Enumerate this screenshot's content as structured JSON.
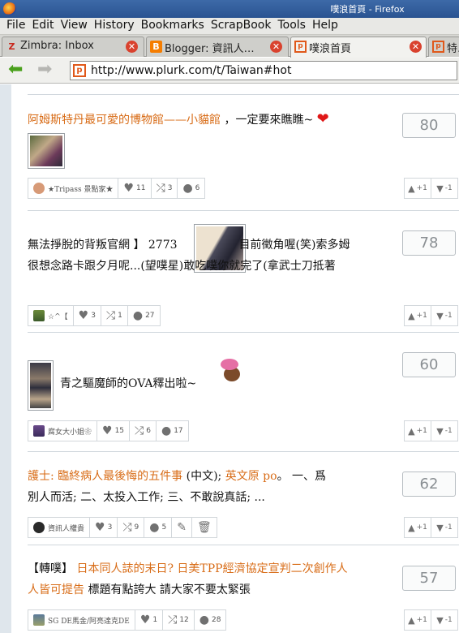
{
  "window": {
    "title": "噗浪首頁 - Firefox"
  },
  "menu": [
    "File",
    "Edit",
    "View",
    "History",
    "Bookmarks",
    "ScrapBook",
    "Tools",
    "Help"
  ],
  "tabs": [
    {
      "label": "Zimbra: Inbox",
      "favicon": "Z"
    },
    {
      "label": "Blogger: 資訊人…",
      "favicon": "B"
    },
    {
      "label": "噗浪首頁",
      "favicon": "p"
    },
    {
      "label": "特…",
      "favicon": "p"
    }
  ],
  "url": "http://www.plurk.com/t/Taiwan#hot",
  "posts": [
    {
      "text": [
        {
          "t": "阿姆斯特丹最可愛的博物館——小貓館",
          "c": "orange"
        },
        {
          "t": " ，一定要來瞧瞧~ ",
          "c": "dark"
        },
        {
          "t": "❤",
          "c": "heart"
        }
      ],
      "count": "80",
      "user": "★Tripass 景點家★",
      "likes": "11",
      "replurks": "3",
      "responses": "6",
      "plus": "+1",
      "minus": "-1"
    },
    {
      "line1a": "無法掙脫的背叛官網 】 2773",
      "line1b": "目前徵角喔(笑)索多姆",
      "line2": "很想念路卡跟夕月呢...(望噗星)敢吃噗你就完了(拿武士刀抵著",
      "count": "78",
      "user": "☆^【",
      "likes": "3",
      "replurks": "1",
      "responses": "27",
      "plus": "+1",
      "minus": "-1"
    },
    {
      "text": "青之驅魔師的OVA釋出啦~",
      "count": "60",
      "user": "腐女大小姐❀",
      "likes": "15",
      "replurks": "6",
      "responses": "17",
      "plus": "+1",
      "minus": "-1"
    },
    {
      "link1": "護士: 臨終病人最後悔的五件事",
      "mid": " (中文); ",
      "link2": "英文原 po",
      "rest1": "。 一、爲",
      "line2": "別人而活; 二、太投入工作; 三、不敢說真話; ...",
      "count": "62",
      "user": "資訊人權貴",
      "likes": "3",
      "replurks": "9",
      "responses": "5",
      "plus": "+1",
      "minus": "-1"
    },
    {
      "prefix": "【轉噗】 ",
      "link": "日本同人誌的末日? 日美TPP經濟協定宣判二次創作人",
      "link2": "人皆可提告",
      "rest": " 標題有點誇大 請大家不要太緊張",
      "count": "57",
      "user": "SG DE馬金/阿亮達克DE",
      "likes": "1",
      "replurks": "12",
      "responses": "28",
      "plus": "+1",
      "minus": "-1"
    }
  ],
  "colors": {
    "accent": "#d86c17",
    "titlebar": "#2a5391"
  }
}
